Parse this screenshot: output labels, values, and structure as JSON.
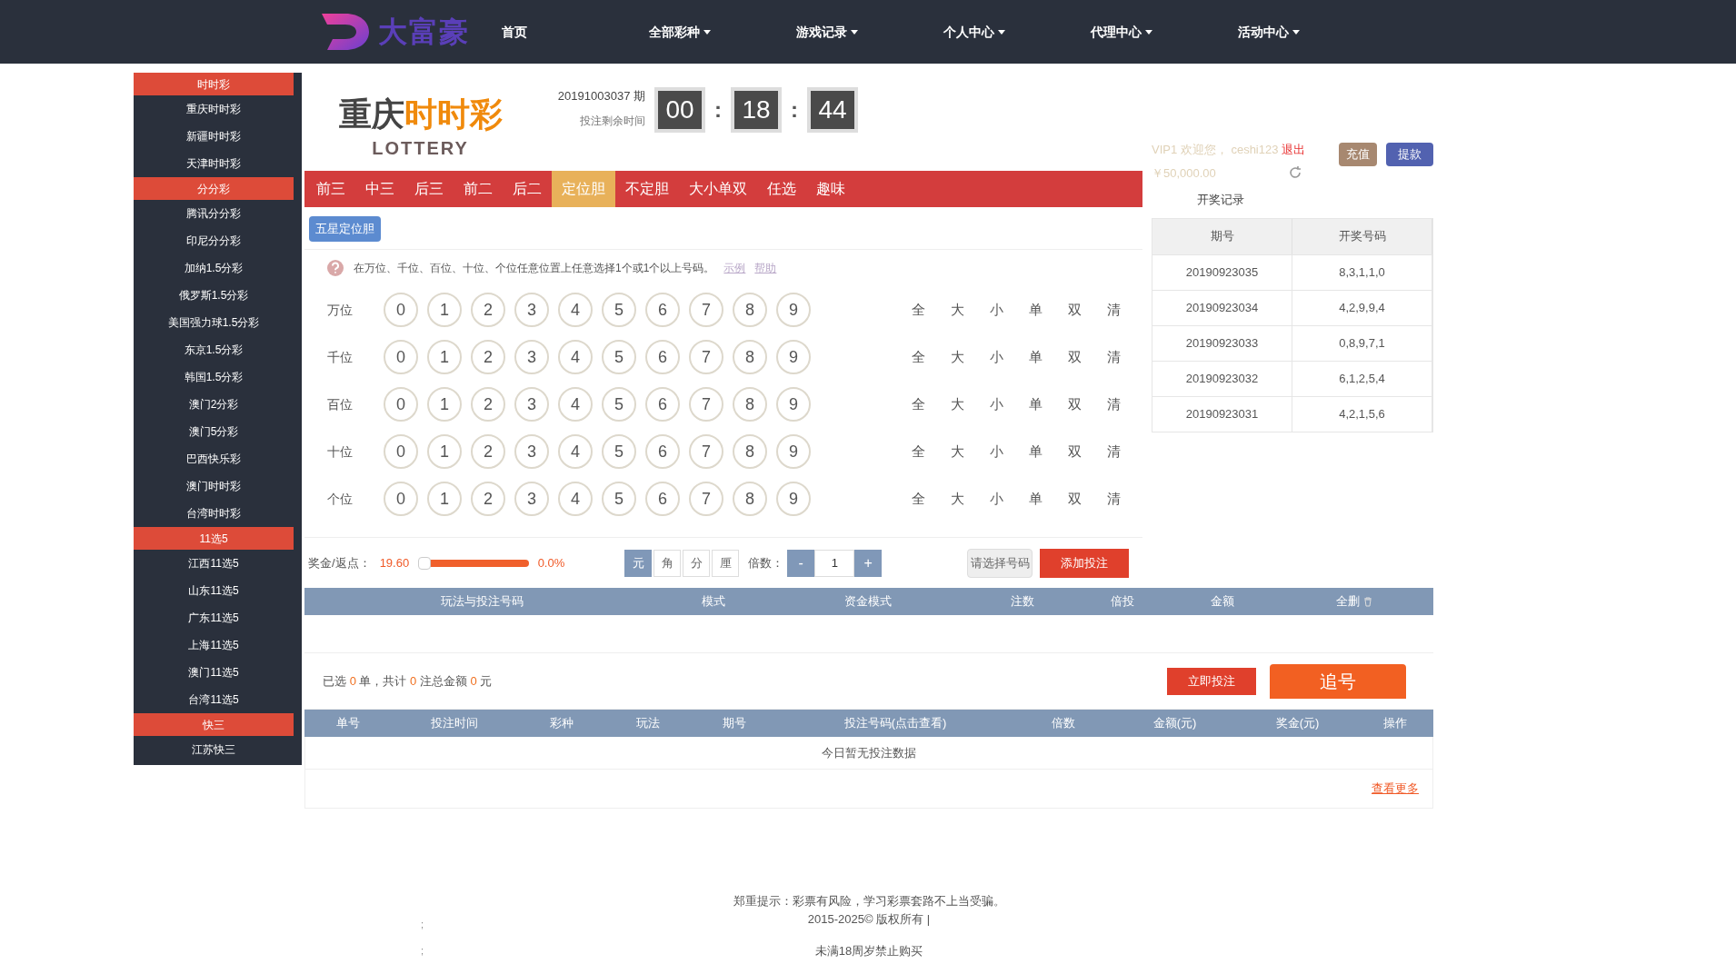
{
  "nav": {
    "brand": "大富豪",
    "items": [
      {
        "label": "首页",
        "dropdown": false
      },
      {
        "label": "全部彩种",
        "dropdown": true
      },
      {
        "label": "游戏记录",
        "dropdown": true
      },
      {
        "label": "个人中心",
        "dropdown": true
      },
      {
        "label": "代理中心",
        "dropdown": true
      },
      {
        "label": "活动中心",
        "dropdown": true
      }
    ]
  },
  "sidebar": {
    "items": [
      {
        "label": "时时彩",
        "kind": "group"
      },
      {
        "label": "重庆时时彩",
        "kind": "link"
      },
      {
        "label": "新疆时时彩",
        "kind": "link"
      },
      {
        "label": "天津时时彩",
        "kind": "link"
      },
      {
        "label": "分分彩",
        "kind": "group"
      },
      {
        "label": "腾讯分分彩",
        "kind": "link"
      },
      {
        "label": "印尼分分彩",
        "kind": "link"
      },
      {
        "label": "加纳1.5分彩",
        "kind": "link"
      },
      {
        "label": "俄罗斯1.5分彩",
        "kind": "link"
      },
      {
        "label": "美国强力球1.5分彩",
        "kind": "link"
      },
      {
        "label": "东京1.5分彩",
        "kind": "link"
      },
      {
        "label": "韩国1.5分彩",
        "kind": "link"
      },
      {
        "label": "澳门2分彩",
        "kind": "link"
      },
      {
        "label": "澳门5分彩",
        "kind": "link"
      },
      {
        "label": "巴西快乐彩",
        "kind": "link"
      },
      {
        "label": "澳门时时彩",
        "kind": "link"
      },
      {
        "label": "台湾时时彩",
        "kind": "link"
      },
      {
        "label": "11选5",
        "kind": "group"
      },
      {
        "label": "江西11选5",
        "kind": "link"
      },
      {
        "label": "山东11选5",
        "kind": "link"
      },
      {
        "label": "广东11选5",
        "kind": "link"
      },
      {
        "label": "上海11选5",
        "kind": "link"
      },
      {
        "label": "澳门11选5",
        "kind": "link"
      },
      {
        "label": "台湾11选5",
        "kind": "link"
      },
      {
        "label": "快三",
        "kind": "group"
      },
      {
        "label": "江苏快三",
        "kind": "link"
      }
    ]
  },
  "game": {
    "title_main": "重庆",
    "title_accent": "时时彩",
    "subtitle": "LOTTERY",
    "period": "20191003037 期",
    "countdown_label": "投注剩余时间",
    "timer": [
      {
        "text": "00",
        "kind": "digits"
      },
      {
        "text": ":",
        "kind": "sep"
      },
      {
        "text": "18",
        "kind": "digits"
      },
      {
        "text": ":",
        "kind": "sep"
      },
      {
        "text": "44",
        "kind": "digits"
      }
    ]
  },
  "tabs": [
    {
      "label": "前三",
      "selected": false
    },
    {
      "label": "中三",
      "selected": false
    },
    {
      "label": "后三",
      "selected": false
    },
    {
      "label": "前二",
      "selected": false
    },
    {
      "label": "后二",
      "selected": false
    },
    {
      "label": "定位胆",
      "selected": true
    },
    {
      "label": "不定胆",
      "selected": false
    },
    {
      "label": "大小单双",
      "selected": false
    },
    {
      "label": "任选",
      "selected": false
    },
    {
      "label": "趣味",
      "selected": false
    }
  ],
  "sub_tab": "五星定位胆",
  "hint": {
    "text": "在万位、千位、百位、十位、个位任意位置上任意选择1个或1个以上号码。",
    "links": [
      "示例",
      "帮助"
    ]
  },
  "rows": [
    {
      "label": "万位",
      "balls": [
        "0",
        "1",
        "2",
        "3",
        "4",
        "5",
        "6",
        "7",
        "8",
        "9"
      ],
      "quick": [
        "全",
        "大",
        "小",
        "单",
        "双",
        "清"
      ]
    },
    {
      "label": "千位",
      "balls": [
        "0",
        "1",
        "2",
        "3",
        "4",
        "5",
        "6",
        "7",
        "8",
        "9"
      ],
      "quick": [
        "全",
        "大",
        "小",
        "单",
        "双",
        "清"
      ]
    },
    {
      "label": "百位",
      "balls": [
        "0",
        "1",
        "2",
        "3",
        "4",
        "5",
        "6",
        "7",
        "8",
        "9"
      ],
      "quick": [
        "全",
        "大",
        "小",
        "单",
        "双",
        "清"
      ]
    },
    {
      "label": "十位",
      "balls": [
        "0",
        "1",
        "2",
        "3",
        "4",
        "5",
        "6",
        "7",
        "8",
        "9"
      ],
      "quick": [
        "全",
        "大",
        "小",
        "单",
        "双",
        "清"
      ]
    },
    {
      "label": "个位",
      "balls": [
        "0",
        "1",
        "2",
        "3",
        "4",
        "5",
        "6",
        "7",
        "8",
        "9"
      ],
      "quick": [
        "全",
        "大",
        "小",
        "单",
        "双",
        "清"
      ]
    }
  ],
  "controls": {
    "rebate_label": "奖金/返点：",
    "prize": "19.60",
    "level": 0,
    "rebate": "0.0%",
    "units": [
      {
        "label": "元",
        "selected": true
      },
      {
        "label": "角",
        "selected": false
      },
      {
        "label": "分",
        "selected": false
      },
      {
        "label": "厘",
        "selected": false
      }
    ],
    "multiple_label": "倍数：",
    "minus": "-",
    "multiple": "1",
    "plus": "+",
    "select_button": "请选择号码",
    "add_button": "添加投注"
  },
  "account": {
    "welcome": "VIP1 欢迎您， ceshi123",
    "logout": "退出",
    "balance": "￥50,000.00",
    "recharge": "充值",
    "withdraw": "提款"
  },
  "draws": {
    "title": "开奖记录",
    "columns": [
      "期号",
      "开奖号码"
    ],
    "rows": [
      [
        "20190923035",
        "8,3,1,1,0"
      ],
      [
        "20190923034",
        "4,2,9,9,4"
      ],
      [
        "20190923033",
        "0,8,9,7,1"
      ],
      [
        "20190923032",
        "6,1,2,5,4"
      ],
      [
        "20190923031",
        "4,2,1,5,6"
      ]
    ]
  },
  "cart": {
    "columns": [
      "玩法与投注号码",
      "模式",
      "资金模式",
      "注数",
      "倍投",
      "金额",
      "全删"
    ]
  },
  "summary": {
    "parts": [
      {
        "text": "已选 ",
        "kind": "label"
      },
      {
        "text": "0",
        "kind": "count"
      },
      {
        "text": " 单，共计 ",
        "kind": "label"
      },
      {
        "text": "0",
        "kind": "count"
      },
      {
        "text": " 注总金额 ",
        "kind": "label"
      },
      {
        "text": "0",
        "kind": "count"
      },
      {
        "text": " 元",
        "kind": "label"
      }
    ],
    "bet_button": "立即投注",
    "chase_button": "追号"
  },
  "history": {
    "columns": [
      "单号",
      "投注时间",
      "彩种",
      "玩法",
      "期号",
      "投注号码(点击查看)",
      "倍数",
      "金额(元)",
      "奖金(元)",
      "操作"
    ],
    "empty": "今日暂无投注数据",
    "more": "查看更多"
  },
  "footer": {
    "lines": [
      "郑重提示：彩票有风险，学习彩票套路不上当受骗。",
      "2015-2025© 版权所有 |",
      "未满18周岁禁止购买"
    ],
    "marks": [
      ";",
      ";"
    ]
  }
}
